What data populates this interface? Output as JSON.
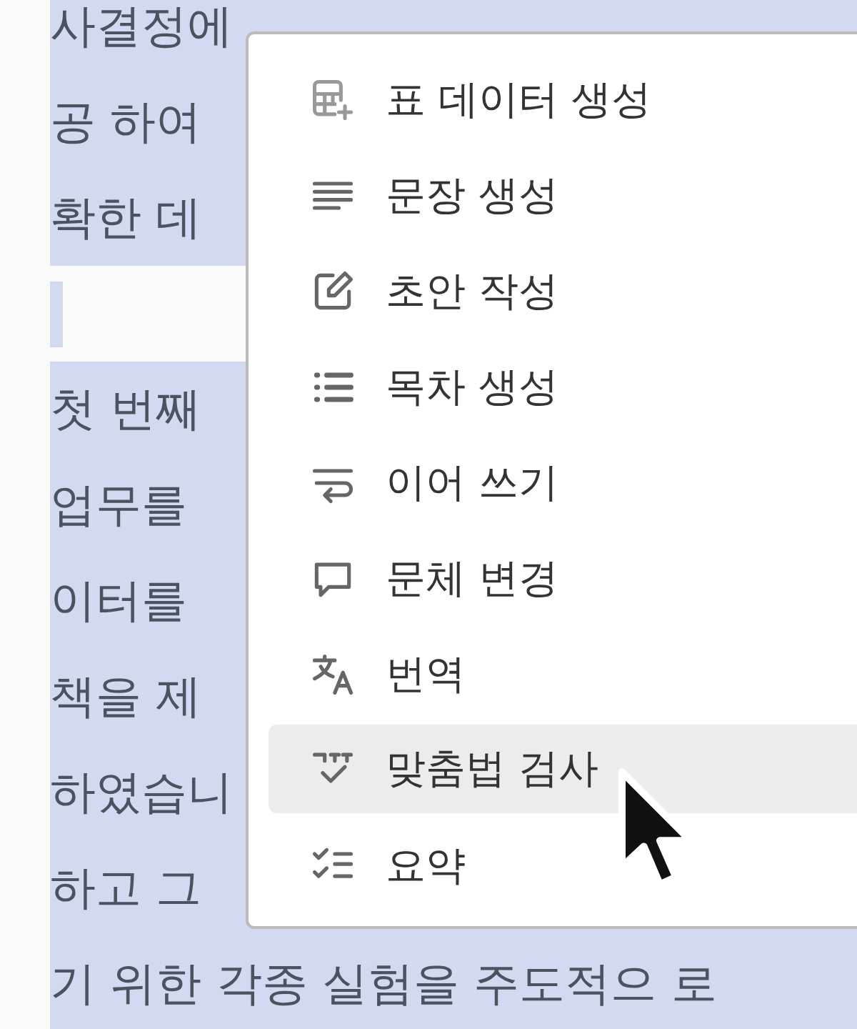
{
  "document": {
    "lines": [
      {
        "kind": "text",
        "text": "사결정에",
        "selected": true
      },
      {
        "kind": "text",
        "text": "공 하여",
        "selected": true
      },
      {
        "kind": "text",
        "text": "확한 데",
        "selected": true
      },
      {
        "kind": "blank",
        "selected": true
      },
      {
        "kind": "text",
        "text": "첫 번째",
        "selected": true
      },
      {
        "kind": "text",
        "text": "업무를",
        "selected": true
      },
      {
        "kind": "text",
        "text": "이터를",
        "selected": true
      },
      {
        "kind": "text",
        "text": "책을 제",
        "selected": true
      },
      {
        "kind": "text",
        "text": "하였습니",
        "selected": true
      },
      {
        "kind": "text",
        "text": "하고 그",
        "selected": true
      },
      {
        "kind": "text",
        "text": "기 위한 각종 실험을 주도적으 로",
        "selected": true
      }
    ]
  },
  "context_menu": {
    "items": [
      {
        "kind": "table",
        "label": "표 데이터 생성",
        "hovered": false
      },
      {
        "kind": "lines",
        "label": "문장 생성",
        "hovered": false
      },
      {
        "kind": "edit",
        "label": "초안 작성",
        "hovered": false
      },
      {
        "kind": "list",
        "label": "목차 생성",
        "hovered": false
      },
      {
        "kind": "wrap",
        "label": "이어 쓰기",
        "hovered": false
      },
      {
        "kind": "comment",
        "label": "문체 변경",
        "hovered": false
      },
      {
        "kind": "translate",
        "label": "번역",
        "hovered": false
      },
      {
        "kind": "spell",
        "label": "맞춤법 검사",
        "hovered": true
      },
      {
        "kind": "checklist",
        "label": "요약",
        "hovered": false
      }
    ]
  }
}
